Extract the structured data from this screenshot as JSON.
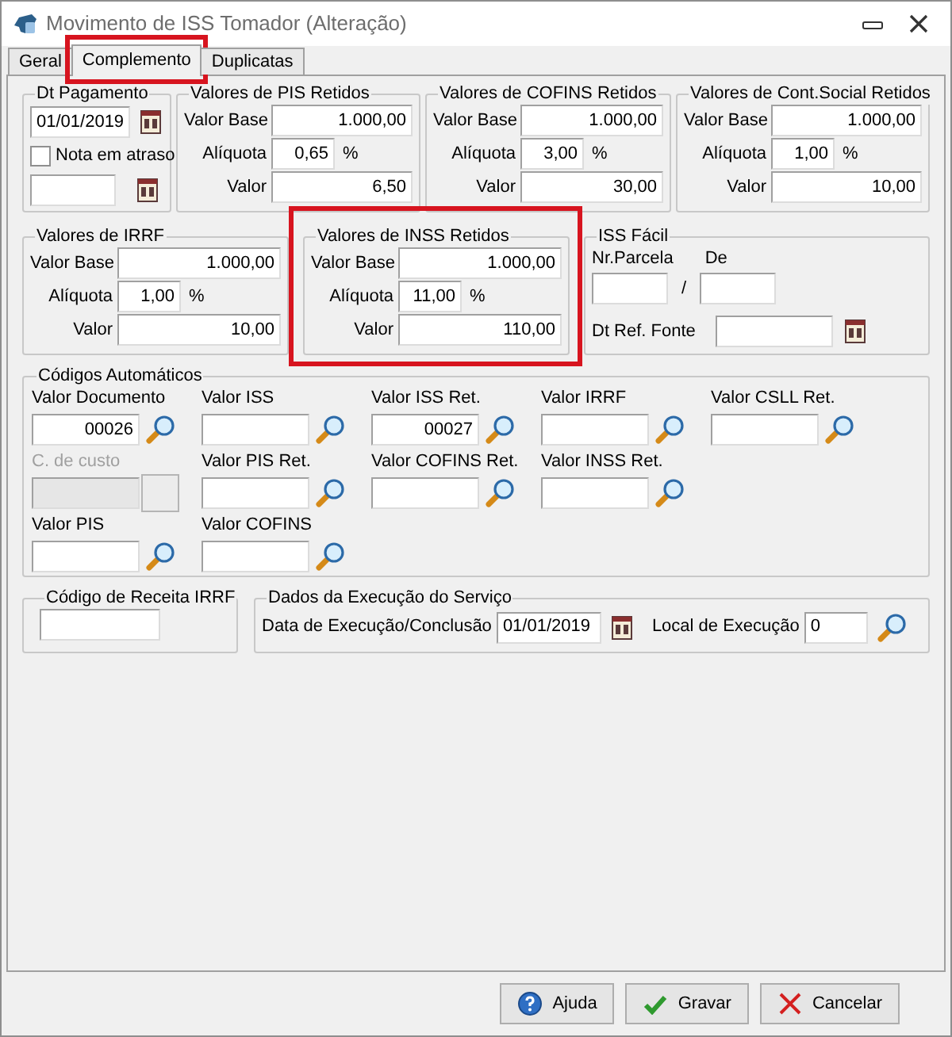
{
  "window": {
    "title": "Movimento de ISS Tomador (Alteração)"
  },
  "tabs": [
    {
      "label": "Geral",
      "selected": false,
      "highlighted": false
    },
    {
      "label": "Complemento",
      "selected": true,
      "highlighted": true
    },
    {
      "label": "Duplicatas",
      "selected": false,
      "highlighted": false
    }
  ],
  "dt_pagamento": {
    "title": "Dt Pagamento",
    "date": "01/01/2019",
    "checkbox": {
      "label": "Nota em atraso",
      "checked": false
    }
  },
  "retention_groups": [
    {
      "title": "Valores de PIS Retidos",
      "highlighted": false,
      "rows": [
        {
          "label": "Valor Base",
          "value": "1.000,00"
        },
        {
          "label": "Alíquota",
          "value": "0,65",
          "unit": "%"
        },
        {
          "label": "Valor",
          "value": "6,50"
        }
      ]
    },
    {
      "title": "Valores de COFINS Retidos",
      "highlighted": false,
      "rows": [
        {
          "label": "Valor Base",
          "value": "1.000,00"
        },
        {
          "label": "Alíquota",
          "value": "3,00",
          "unit": "%"
        },
        {
          "label": "Valor",
          "value": "30,00"
        }
      ]
    },
    {
      "title": "Valores de Cont.Social Retidos",
      "highlighted": false,
      "rows": [
        {
          "label": "Valor Base",
          "value": "1.000,00"
        },
        {
          "label": "Alíquota",
          "value": "1,00",
          "unit": "%"
        },
        {
          "label": "Valor",
          "value": "10,00"
        }
      ]
    },
    {
      "title": "Valores de IRRF",
      "highlighted": false,
      "rows": [
        {
          "label": "Valor Base",
          "value": "1.000,00"
        },
        {
          "label": "Alíquota",
          "value": "1,00",
          "unit": "%"
        },
        {
          "label": "Valor",
          "value": "10,00"
        }
      ]
    },
    {
      "title": "Valores de INSS Retidos",
      "highlighted": true,
      "rows": [
        {
          "label": "Valor Base",
          "value": "1.000,00"
        },
        {
          "label": "Alíquota",
          "value": "11,00",
          "unit": "%"
        },
        {
          "label": "Valor",
          "value": "110,00"
        }
      ]
    }
  ],
  "iss_facil": {
    "title": "ISS Fácil",
    "parcela_label": "Nr.Parcela",
    "de_label": "De",
    "separator": "/",
    "ref_label": "Dt Ref. Fonte"
  },
  "codigos": {
    "title": "Códigos Automáticos",
    "rows": [
      [
        {
          "label": "Valor Documento",
          "value": "00026",
          "disabled": false
        },
        {
          "label": "Valor ISS",
          "disabled": false
        },
        {
          "label": "Valor ISS Ret.",
          "value": "00027",
          "disabled": false
        },
        {
          "label": "Valor IRRF",
          "disabled": false
        },
        {
          "label": "Valor CSLL Ret.",
          "disabled": false
        }
      ],
      [
        {
          "label": "C. de custo",
          "disabled": true
        },
        {
          "label": "Valor PIS Ret.",
          "disabled": false
        },
        {
          "label": "Valor COFINS Ret.",
          "disabled": false
        },
        {
          "label": "Valor INSS Ret.",
          "disabled": false
        }
      ],
      [
        {
          "label": "Valor PIS",
          "disabled": false
        },
        {
          "label": "Valor COFINS",
          "disabled": false
        }
      ]
    ]
  },
  "codigo_receita": {
    "title": "Código de Receita IRRF"
  },
  "execucao": {
    "title": "Dados da Execução do Serviço",
    "date_label": "Data de Execução/Conclusão",
    "date": "01/01/2019",
    "local_label": "Local de Execução",
    "local": "0"
  },
  "buttons": [
    {
      "label": "Ajuda",
      "kind": "help"
    },
    {
      "label": "Gravar",
      "kind": "save"
    },
    {
      "label": "Cancelar",
      "kind": "cancel"
    }
  ]
}
